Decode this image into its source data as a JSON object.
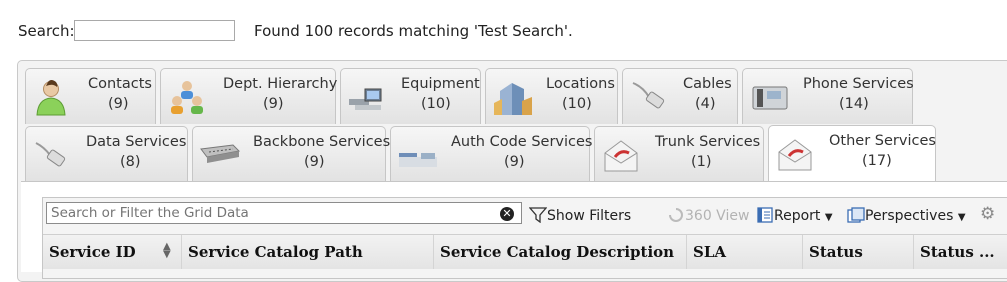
{
  "search": {
    "label": "Search:",
    "value": "",
    "result_text": "Found 100 records matching 'Test Search'."
  },
  "tabs": [
    {
      "label": "Contacts",
      "count": "(9)",
      "icon": "contact-person-icon"
    },
    {
      "label": "Dept. Hierarchy",
      "count": "(9)",
      "icon": "dept-hierarchy-icon"
    },
    {
      "label": "Equipment",
      "count": "(10)",
      "icon": "equipment-icon"
    },
    {
      "label": "Locations",
      "count": "(10)",
      "icon": "building-icon"
    },
    {
      "label": "Cables",
      "count": "(4)",
      "icon": "cable-icon"
    },
    {
      "label": "Phone Services",
      "count": "(14)",
      "icon": "phone-icon"
    },
    {
      "label": "Data Services",
      "count": "(8)",
      "icon": "network-cable-icon"
    },
    {
      "label": "Backbone Services",
      "count": "(9)",
      "icon": "patch-panel-icon"
    },
    {
      "label": "Auth Code Services",
      "count": "(9)",
      "icon": "hardware-icon"
    },
    {
      "label": "Trunk Services",
      "count": "(1)",
      "icon": "envelope-icon"
    },
    {
      "label": "Other Services",
      "count": "(17)",
      "icon": "envelope-icon",
      "active": true
    }
  ],
  "toolbar": {
    "filter_placeholder": "Search or Filter the Grid Data",
    "show_filters": "Show Filters",
    "view_360": "360 View",
    "report": "Report",
    "perspectives": "Perspectives"
  },
  "grid": {
    "columns": [
      "Service ID",
      "Service Catalog Path",
      "Service Catalog Description",
      "SLA",
      "Status",
      "Status ..."
    ]
  }
}
